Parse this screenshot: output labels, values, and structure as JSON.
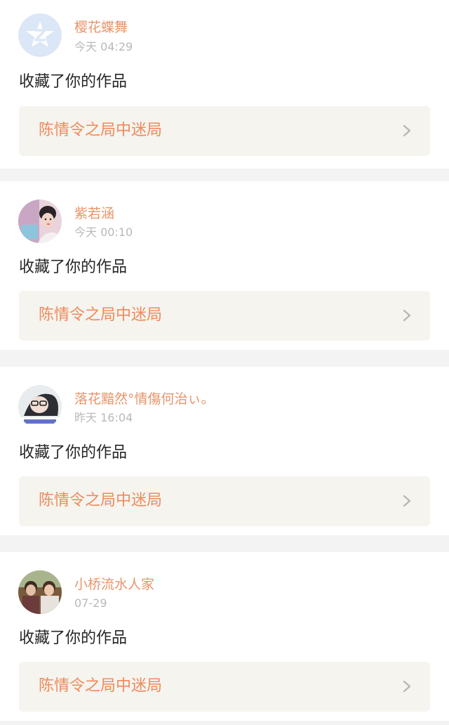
{
  "notifications": [
    {
      "username": "樱花蝶舞",
      "time": "今天 04:29",
      "action": "收藏了你的作品",
      "work_title": "陈情令之局中迷局",
      "avatar_icon": "default-avatar-icon"
    },
    {
      "username": "紫若涵",
      "time": "今天 00:10",
      "action": "收藏了你的作品",
      "work_title": "陈情令之局中迷局",
      "avatar_icon": "user-photo-avatar"
    },
    {
      "username": "落花黯然°情傷何治ぃ。",
      "time": "昨天 16:04",
      "action": "收藏了你的作品",
      "work_title": "陈情令之局中迷局",
      "avatar_icon": "user-photo-avatar"
    },
    {
      "username": "小桥流水人家",
      "time": "07-29",
      "action": "收藏了你的作品",
      "work_title": "陈情令之局中迷局",
      "avatar_icon": "user-photo-avatar"
    }
  ],
  "colors": {
    "username": "#e8946a",
    "work_title": "#ef8a5c",
    "time": "#b9b9b9",
    "work_bg": "#f5f4ef",
    "page_bg": "#f4f3f3"
  }
}
